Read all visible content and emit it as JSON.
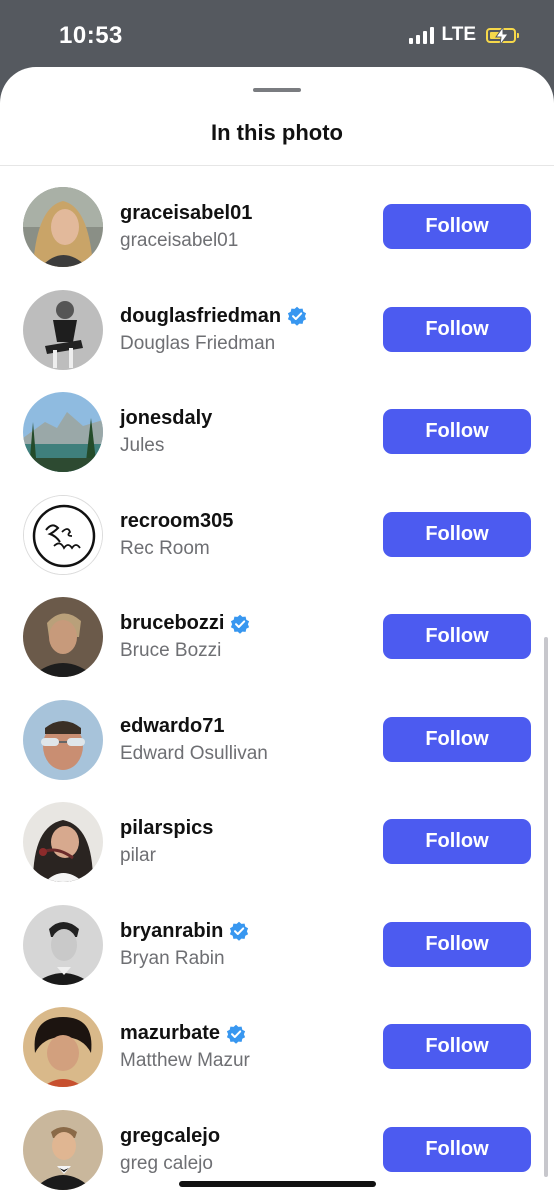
{
  "status_bar": {
    "time": "10:53",
    "network": "LTE",
    "signal_bars": 4,
    "battery_icon": "battery-charging-icon"
  },
  "sheet": {
    "title": "In this photo"
  },
  "colors": {
    "accent": "#4c5bf0",
    "verified": "#3897f0",
    "text_primary": "#111111",
    "text_secondary": "#6e6f73"
  },
  "people": [
    {
      "username": "graceisabel01",
      "name": "graceisabel01",
      "verified": false,
      "button": "Follow"
    },
    {
      "username": "douglasfriedman",
      "name": "Douglas Friedman",
      "verified": true,
      "button": "Follow"
    },
    {
      "username": "jonesdaly",
      "name": "Jules",
      "verified": false,
      "button": "Follow"
    },
    {
      "username": "recroom305",
      "name": "Rec Room",
      "verified": false,
      "button": "Follow"
    },
    {
      "username": "brucebozzi",
      "name": "Bruce Bozzi",
      "verified": true,
      "button": "Follow"
    },
    {
      "username": "edwardo71",
      "name": "Edward Osullivan",
      "verified": false,
      "button": "Follow"
    },
    {
      "username": "pilarspics",
      "name": "pilar",
      "verified": false,
      "button": "Follow"
    },
    {
      "username": "bryanrabin",
      "name": "Bryan Rabin",
      "verified": true,
      "button": "Follow"
    },
    {
      "username": "mazurbate",
      "name": "Matthew Mazur",
      "verified": true,
      "button": "Follow"
    },
    {
      "username": "gregcalejo",
      "name": "greg calejo",
      "verified": false,
      "button": "Follow"
    }
  ]
}
